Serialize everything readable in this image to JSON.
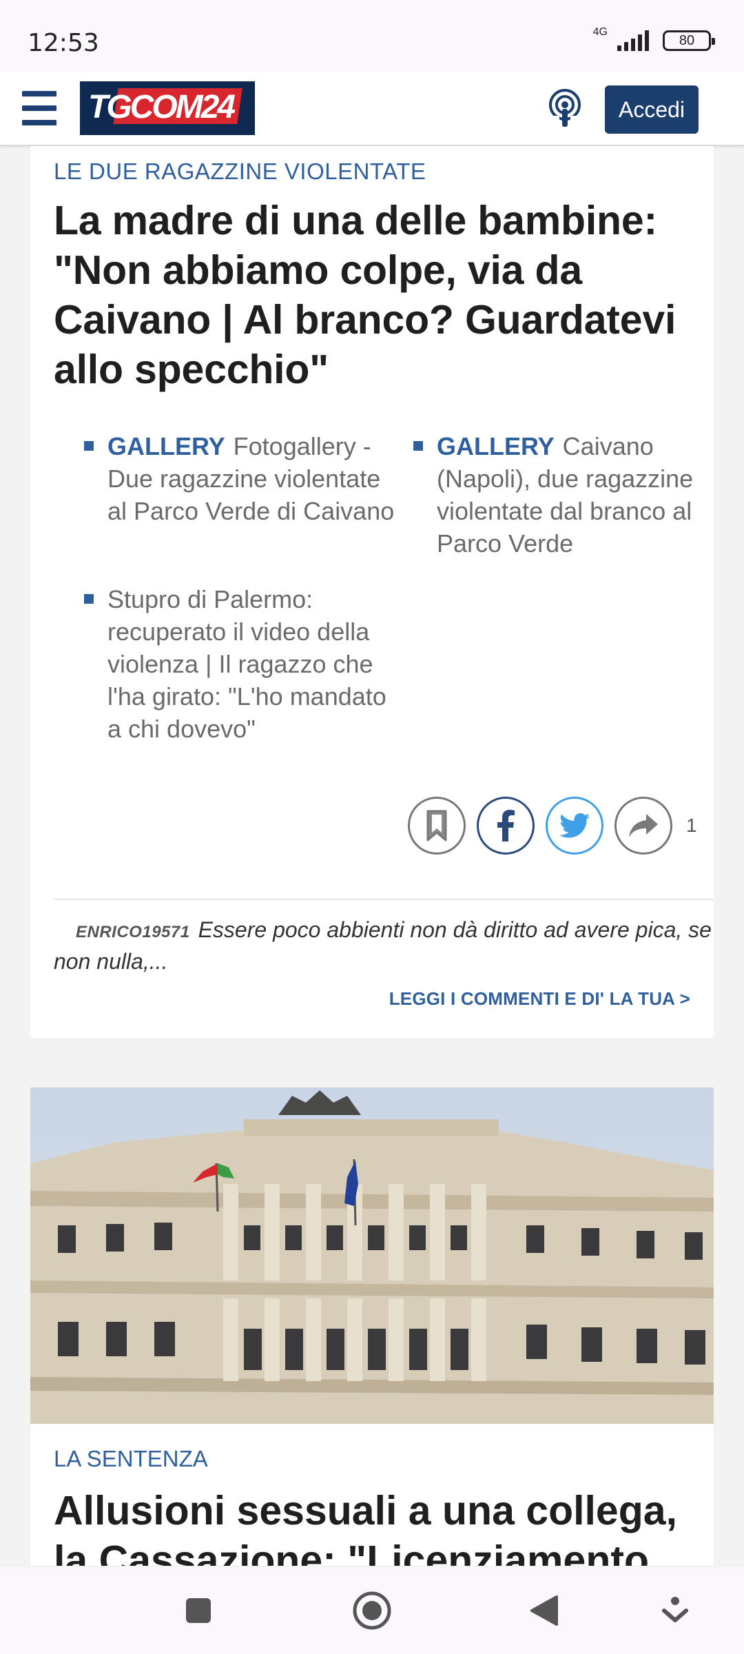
{
  "status": {
    "time": "12:53",
    "network": "4G",
    "battery": "80"
  },
  "header": {
    "logo_text": "TGCOM24",
    "login_label": "Accedi"
  },
  "article": {
    "kicker": "LE DUE RAGAZZINE VIOLENTATE",
    "headline": "La madre di una delle bambine: \"Non abbiamo colpe, via da Caivano | Al branco?  Guardatevi allo specchio\"",
    "related": [
      {
        "tag": "GALLERY",
        "text": "Fotogallery - Due ragazzine violentate al Parco Verde di Caivano"
      },
      {
        "tag": "GALLERY",
        "text": "Caivano (Napoli), due ragazzine violentate dal branco al Parco Verde"
      },
      {
        "tag": "",
        "text": "Stupro di Palermo: recuperato il video della violenza | Il ragazzo che l'ha girato: \"L'ho mandato a chi dovevo\""
      }
    ],
    "share_count": "1",
    "comment": {
      "user": "ENRICO19571",
      "text": "Essere poco abbienti non dà diritto ad avere pica, se non nulla,..."
    },
    "comments_link": "LEGGI I COMMENTI E DI' LA TUA >"
  },
  "article2": {
    "kicker": "LA SENTENZA",
    "headline": "Allusioni sessuali a una collega, la Cassazione: \"Licenziamento"
  },
  "colors": {
    "brand_navy": "#1b3e6f",
    "accent_blue": "#2f5f9e",
    "logo_red": "#d8262f"
  }
}
